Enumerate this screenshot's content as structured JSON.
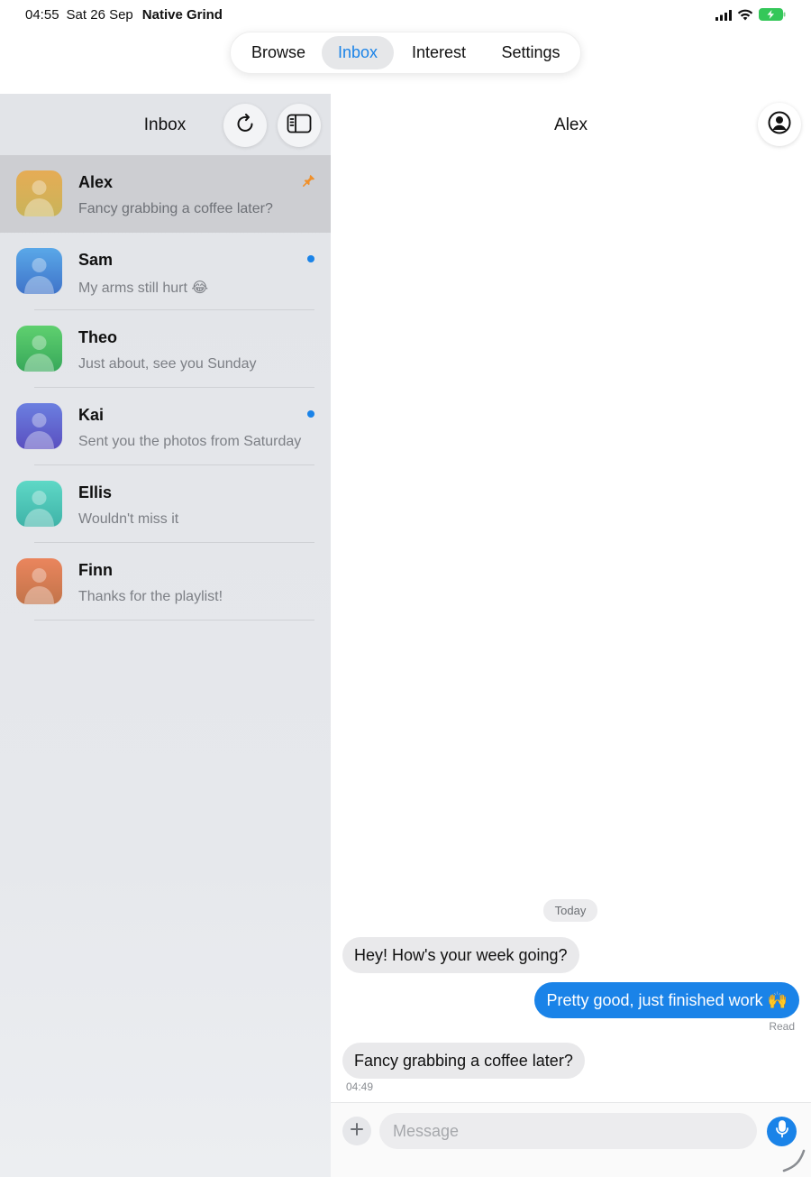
{
  "status_bar": {
    "time": "04:55",
    "date": "Sat 26 Sep",
    "app_name": "Native Grind",
    "icons": [
      "signal-icon",
      "wifi-icon",
      "battery-charging-icon"
    ],
    "battery_color": "#34c759"
  },
  "top_tabs": {
    "items": [
      {
        "label": "Browse"
      },
      {
        "label": "Inbox"
      },
      {
        "label": "Interest"
      },
      {
        "label": "Settings"
      }
    ],
    "active": "Inbox",
    "accent_color": "#1a83e8"
  },
  "sidebar": {
    "title": "Inbox",
    "buttons": [
      "refresh-icon",
      "sidebar-toggle-icon"
    ],
    "conversations": [
      {
        "name": "Alex",
        "preview": "Fancy grabbing a coffee later?",
        "pinned": true,
        "unread": false,
        "selected": true,
        "avatar_colors": [
          "#e6ac55",
          "#c9b45a"
        ],
        "pin_color": "#f0902a"
      },
      {
        "name": "Sam",
        "preview": "My arms still hurt 😂",
        "pinned": false,
        "unread": true,
        "avatar_colors": [
          "#5aa8e8",
          "#3f73c9"
        ]
      },
      {
        "name": "Theo",
        "preview": "Just about, see you Sunday",
        "pinned": false,
        "unread": false,
        "avatar_colors": [
          "#5fd06f",
          "#37a85a"
        ]
      },
      {
        "name": "Kai",
        "preview": "Sent you the photos from Saturday",
        "pinned": false,
        "unread": true,
        "avatar_colors": [
          "#6b7fe0",
          "#5a4fc0"
        ]
      },
      {
        "name": "Ellis",
        "preview": "Wouldn't miss it",
        "pinned": false,
        "unread": false,
        "avatar_colors": [
          "#5ed8c6",
          "#3fb3a8"
        ]
      },
      {
        "name": "Finn",
        "preview": "Thanks for the playlist!",
        "pinned": false,
        "unread": false,
        "avatar_colors": [
          "#ea855d",
          "#c2744a"
        ]
      }
    ]
  },
  "chat": {
    "title": "Alex",
    "profile_icon": "person-circle-icon",
    "date_separator": "Today",
    "messages": [
      {
        "direction": "in",
        "text": "Hey! How's your week going?"
      },
      {
        "direction": "out",
        "text": "Pretty good, just finished work 🙌",
        "status": "Read"
      },
      {
        "direction": "in",
        "text": "Fancy grabbing a coffee later?",
        "time": "04:49"
      }
    ],
    "composer": {
      "placeholder": "Message",
      "value": "",
      "icons": [
        "plus-icon",
        "microphone-icon"
      ]
    }
  }
}
